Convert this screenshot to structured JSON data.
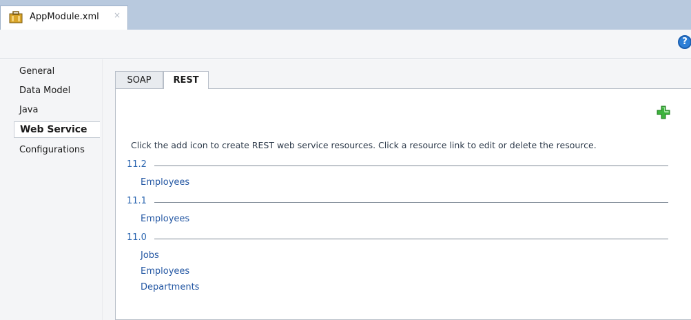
{
  "editor": {
    "tab": {
      "filename": "AppModule.xml",
      "close_symbol": "×",
      "icon": "application-module-icon"
    }
  },
  "toolbar": {
    "help_symbol": "?",
    "help_icon": "help-icon"
  },
  "sidebar": {
    "items": [
      {
        "label": "General",
        "selected": false
      },
      {
        "label": "Data Model",
        "selected": false
      },
      {
        "label": "Java",
        "selected": false
      },
      {
        "label": "Web Service",
        "selected": true
      },
      {
        "label": "Configurations",
        "selected": false
      }
    ]
  },
  "main": {
    "tabs": [
      {
        "label": "SOAP",
        "active": false
      },
      {
        "label": "REST",
        "active": true
      }
    ],
    "add_icon": "add-plus-icon",
    "instruction": "Click the add icon to create REST web service resources. Click a resource link to edit or delete the resource.",
    "versions": [
      {
        "label": "11.2",
        "resources": [
          "Employees"
        ]
      },
      {
        "label": "11.1",
        "resources": [
          "Employees"
        ]
      },
      {
        "label": "11.0",
        "resources": [
          "Jobs",
          "Employees",
          "Departments"
        ]
      }
    ]
  },
  "colors": {
    "tabstrip": "#b8c9de",
    "link": "#2457a3",
    "version": "#2c66b0",
    "add_icon": "#2fa62f",
    "help_icon": "#2d7fd7"
  }
}
